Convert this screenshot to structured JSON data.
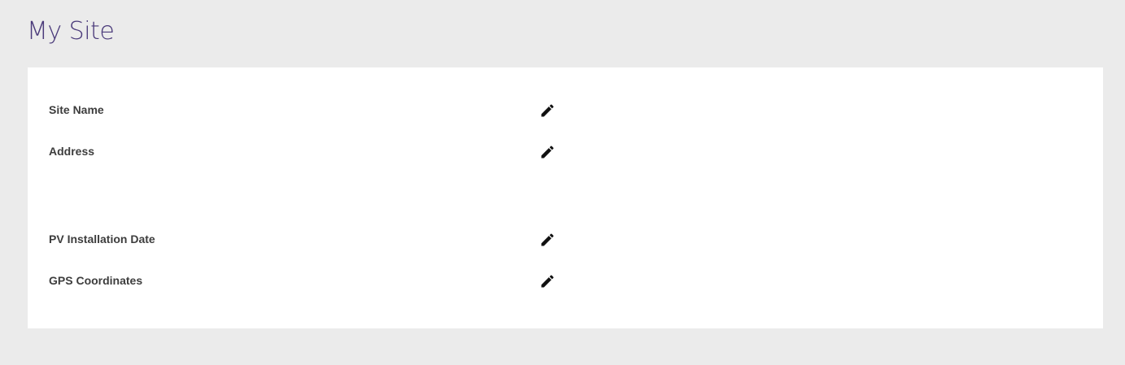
{
  "page": {
    "title": "My Site"
  },
  "fields": [
    {
      "label": "Site Name",
      "icon": "pencil-icon"
    },
    {
      "label": "Address",
      "icon": "pencil-icon"
    },
    {
      "label": "PV Installation Date",
      "icon": "pencil-icon"
    },
    {
      "label": "GPS Coordinates",
      "icon": "pencil-icon"
    }
  ],
  "colors": {
    "background": "#ebebeb",
    "card": "#ffffff",
    "title": "#4a3a7a",
    "label": "#3d3d3d",
    "icon": "#111111"
  }
}
